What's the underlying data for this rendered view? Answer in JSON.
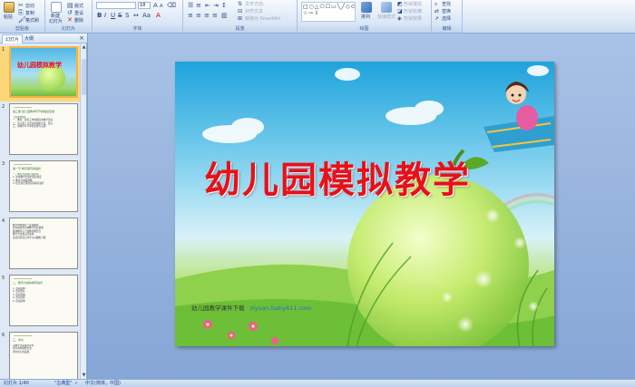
{
  "ribbon": {
    "groups": [
      {
        "id": "clipboard",
        "label": "剪贴板",
        "items": [
          "粘贴",
          "剪切",
          "复制",
          "格式刷"
        ]
      },
      {
        "id": "slides",
        "label": "幻灯片",
        "items": [
          "新建",
          "幻灯片",
          "版式",
          "重设",
          "删除"
        ]
      },
      {
        "id": "font",
        "label": "字体"
      },
      {
        "id": "paragraph",
        "label": "段落"
      },
      {
        "id": "drawing",
        "label": "绘图",
        "items": [
          "排列",
          "快速样式",
          "形状填充",
          "形状轮廓",
          "形状效果"
        ]
      },
      {
        "id": "editing",
        "label": "编辑",
        "items": [
          "查找",
          "替换",
          "选择"
        ]
      }
    ],
    "paragraph_items": [
      "文字方向",
      "对齐文本",
      "转换为 SmartArt"
    ],
    "font_size_value": "18"
  },
  "left_pane": {
    "tabs": [
      "幻灯片",
      "大纲"
    ],
    "close": "×",
    "slides": [
      {
        "num": "1",
        "title": "幼儿园模拟教学"
      },
      {
        "num": "2",
        "title": "第三章 幼儿园教学环节的组织实施",
        "lines": [
          "【主要内容】",
          "一、教育、保育工作将相应的教学活动",
          "二、幼儿园一日活动的组织方法、目标",
          "三、在教学环节中的安排与实施"
        ]
      },
      {
        "num": "3",
        "title": "第一节 教育保育的组织",
        "lines": [
          "一、教育方案制订的原则",
          "1. 注重教育方案的目标制定",
          "2. 教育方案要遵循",
          "3. 结合幼儿园的实际情况进行"
        ]
      },
      {
        "num": "4",
        "title": "",
        "lines": [
          "教学内容要有一定系统性",
          "各年龄班的具体教学目标要求",
          "集体教育与个别教育相结合",
          "教学方法要灵活多样",
          "注意培养幼儿的学习兴趣和习惯"
        ]
      },
      {
        "num": "5",
        "title": "二、教育方案的撰写格式",
        "lines": [
          "1. 活动名称",
          "2. 活动目标",
          "3. 活动准备",
          "4. 活动过程",
          "5. 活动延伸"
        ]
      },
      {
        "num": "6",
        "title": "三、评价",
        "lines": [
          "对教学活动进行评价",
          "评价的内容和方法",
          "评价幼儿的发展"
        ]
      }
    ]
  },
  "main_slide": {
    "title": "幼儿园模拟教学",
    "footer_text": "幼儿园教学课件下载",
    "footer_url": "ziyuan.baby611.com"
  },
  "status": {
    "slide_pos": "幻灯片 1/40",
    "theme": "\"古典型\"",
    "language": "中文(简体，中国)"
  },
  "colors": {
    "title_red": "#e8101a",
    "ribbon_bg": "#dbe7f6",
    "selection": "#f5b245"
  }
}
